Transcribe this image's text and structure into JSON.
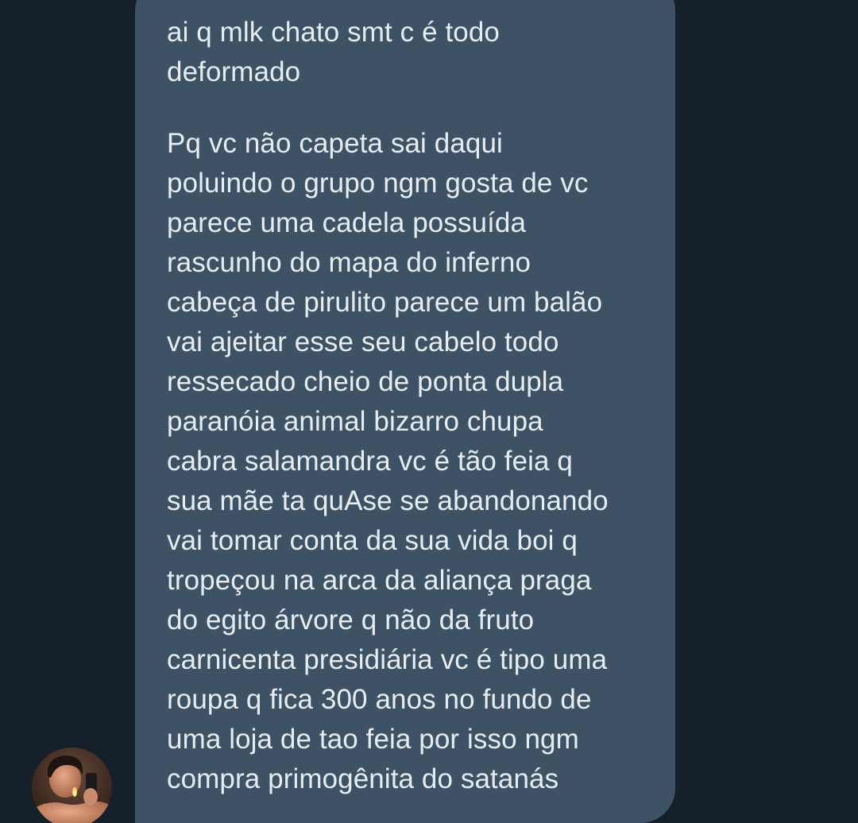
{
  "conversation": {
    "message": {
      "lines_top": [
        "ai q mlk chato smt c é todo",
        "deformado"
      ],
      "lines_bottom": [
        "Pq vc não capeta sai daqui",
        "poluindo o grupo ngm gosta de vc",
        "parece uma cadela possuída",
        "rascunho do mapa do inferno",
        "cabeça de pirulito parece um balão",
        "vai ajeitar esse seu cabelo todo",
        "ressecado cheio de ponta dupla",
        "paranóia animal bizarro chupa",
        "cabra salamandra vc é tão feia q",
        "sua mãe ta quAse se abandonando",
        "vai tomar conta da sua vida boi q",
        "tropeçou na arca da aliança praga",
        "do egito árvore q não da fruto",
        "carnicenta presidiária vc é tipo uma",
        "roupa q fica 300 anos no fundo de",
        "uma loja de tao feia por isso ngm",
        "compra primogênita do satanás"
      ]
    },
    "sender_avatar": "avatar-photo"
  },
  "colors": {
    "background": "#16202b",
    "bubble": "#3d5365",
    "text": "#e7ecf0"
  }
}
